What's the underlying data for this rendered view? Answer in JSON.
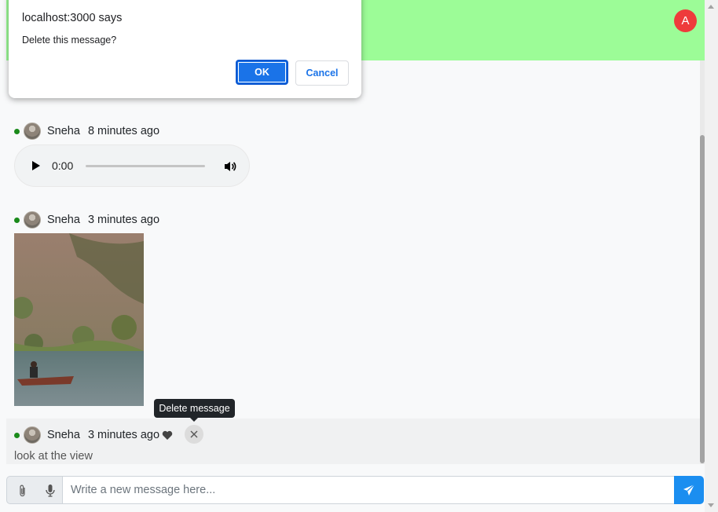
{
  "header": {
    "user_initial": "A"
  },
  "messages": [
    {
      "author": "Sneha",
      "time": "8 minutes ago",
      "type": "audio",
      "audio_time": "0:00"
    },
    {
      "author": "Sneha",
      "time": "3 minutes ago",
      "type": "image"
    },
    {
      "author": "Sneha",
      "time": "3 minutes ago",
      "type": "text",
      "text": "look at the view"
    }
  ],
  "tooltip": "Delete message",
  "composer": {
    "placeholder": "Write a new message here..."
  },
  "dialog": {
    "title": "localhost:3000 says",
    "message": "Delete this message?",
    "ok_label": "OK",
    "cancel_label": "Cancel"
  },
  "colors": {
    "header_bg": "#9cfc97",
    "avatar_bg": "#ee3b3b",
    "send_btn": "#1b8ef0",
    "dialog_ok": "#1a73e8",
    "online": "#1a8a1a"
  },
  "icons": [
    "paperclip-icon",
    "microphone-icon",
    "send-icon",
    "heart-icon",
    "close-icon",
    "play-icon",
    "volume-icon"
  ]
}
